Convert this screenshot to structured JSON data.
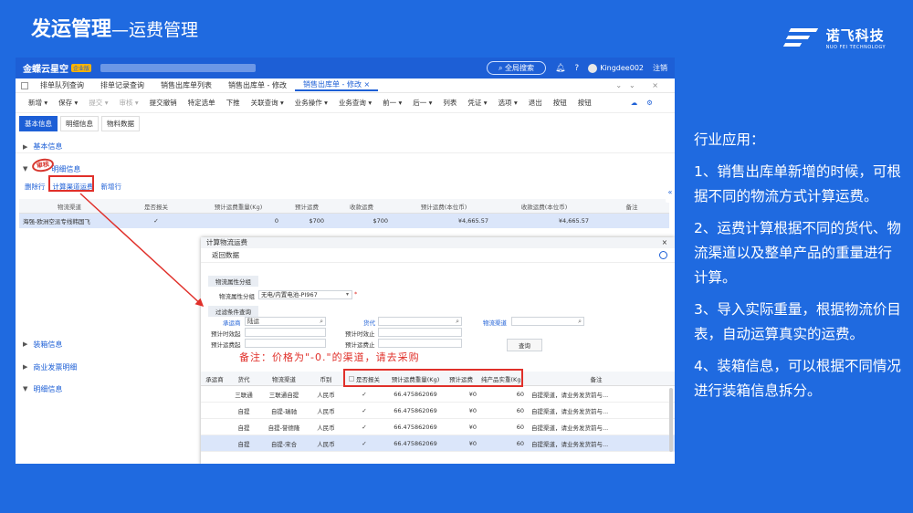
{
  "slide": {
    "title": "发运管理",
    "subtitle": "—运费管理",
    "logo_cn": "诺飞科技",
    "logo_en": "NUO FEI TECHNOLOGY"
  },
  "app": {
    "brand": "金蝶云星空",
    "badge": "企业版",
    "search": "全局搜索",
    "user": "Kingdee002",
    "logout": "注销",
    "tabs": [
      "排单队列查询",
      "排单记录查询",
      "销售出库单列表",
      "销售出库单 - 修改",
      "销售出库单 - 修改 ×"
    ],
    "toolbar": [
      "新增 ▾",
      "保存 ▾",
      "提交 ▾",
      "审核 ▾",
      "提交撤销",
      "特定选单",
      "下推",
      "关联查询 ▾",
      "业务操作 ▾",
      "业务查询 ▾",
      "前一 ▾",
      "后一 ▾",
      "列表",
      "凭证 ▾",
      "选项 ▾",
      "退出",
      "按钮",
      "按钮"
    ],
    "subtabs": [
      "基本信息",
      "明细信息",
      "物料数据"
    ],
    "sections": {
      "basic": "基本信息",
      "detail": "明细信息",
      "packing": "装箱信息",
      "invoice": "商业发票明细",
      "detail2": "明细信息"
    },
    "stamp": "审核",
    "detail_actions": [
      "删除行",
      "计算渠道运费",
      "新增行"
    ],
    "grid1": {
      "headers": [
        "物流渠道",
        "是否报关",
        "预计运费重量(Kg)",
        "预计运费",
        "收款运费",
        "预计运费(本位币)",
        "收款运费(本位币)",
        "备注"
      ],
      "row": [
        "海强-欧洲空派专线韩国飞",
        "✓",
        "0",
        "$700",
        "$700",
        "¥4,665.57",
        "¥4,665.57",
        ""
      ]
    }
  },
  "popup": {
    "title": "计算物流运费",
    "back": "返回数据",
    "group1": "物流属性分组",
    "attr_label": "物流属性分组",
    "attr_value": "无电/内置电池-PI967",
    "group2": "过滤条件查询",
    "carrier_label": "承运商",
    "carrier_value": "陆运",
    "mode_label": "货代",
    "channel_label": "物流渠道",
    "start_label": "预计时效起",
    "end_label": "预计时效止",
    "fee_start_label": "预计运费起",
    "fee_end_label": "预计运费止",
    "query": "查询",
    "note": "备注：价格为\"-0.\"的渠道，请去采购",
    "grid": {
      "headers": [
        "承运商",
        "货代",
        "物流渠道",
        "币别",
        "是否报关",
        "预计运费重量(Kg)",
        "预计运费",
        "纯产品实重(Kg)",
        "备注"
      ],
      "rows": [
        [
          "",
          "三联通",
          "三联通自提",
          "人民币",
          "✓",
          "66.475862069",
          "¥0",
          "60",
          "自提渠道，请业务发货前与..."
        ],
        [
          "",
          "自提",
          "自提-瑞驰",
          "人民币",
          "✓",
          "66.475862069",
          "¥0",
          "60",
          "自提渠道，请业务发货前与..."
        ],
        [
          "",
          "自提",
          "自提-誉德隆",
          "人民币",
          "✓",
          "66.475862069",
          "¥0",
          "60",
          "自提渠道，请业务发货前与..."
        ],
        [
          "",
          "自提",
          "自提-宋合",
          "人民币",
          "✓",
          "66.475862069",
          "¥0",
          "60",
          "自提渠道，请业务发货前与..."
        ]
      ]
    }
  },
  "side": {
    "heading": "行业应用：",
    "points": [
      "1、销售出库单新增的时候，可根据不同的物流方式计算运费。",
      "2、运费计算根据不同的货代、物流渠道以及整单产品的重量进行计算。",
      "3、导入实际重量，根据物流价目表，自动运算真实的运费。",
      "4、装箱信息，可以根据不同情况进行装箱信息拆分。"
    ]
  },
  "colors": {
    "background": "#1f6ae0",
    "app_header": "#1d5fd6",
    "highlight_box": "#e0302a"
  }
}
